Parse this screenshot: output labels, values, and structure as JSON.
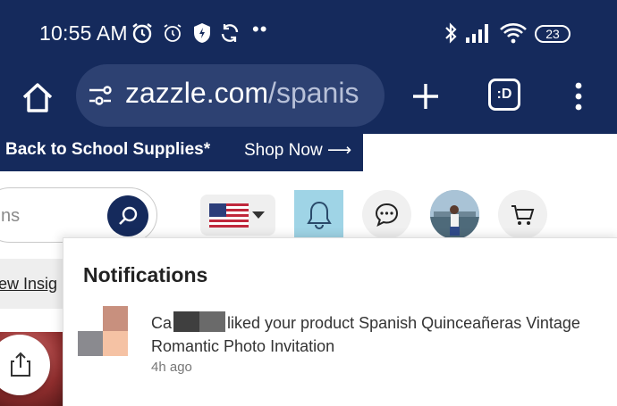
{
  "status_bar": {
    "time": "10:55 AM",
    "dots": "••",
    "battery": "23"
  },
  "browser": {
    "url_domain": "zazzle.com",
    "url_path": "/spanis",
    "tabs_label": ":D"
  },
  "promo": {
    "text": "Back to School Supplies*",
    "link": "Shop Now ⟶"
  },
  "header": {
    "search_placeholder_visible": "ns"
  },
  "page": {
    "insights_link": "ew Insig"
  },
  "notifications": {
    "title": "Notifications",
    "items": [
      {
        "text_prefix": "Ca",
        "text_suffix": "liked your product Spanish Quinceañeras Vintage Romantic Photo Invitation",
        "time": "4h ago",
        "thumb_colors": [
          "#ffffff",
          "#c8907e",
          "#8a8a8f",
          "#f5c2a4"
        ]
      }
    ]
  },
  "colors": {
    "navy": "#152a5c",
    "bell_active": "#9fd4e6"
  }
}
